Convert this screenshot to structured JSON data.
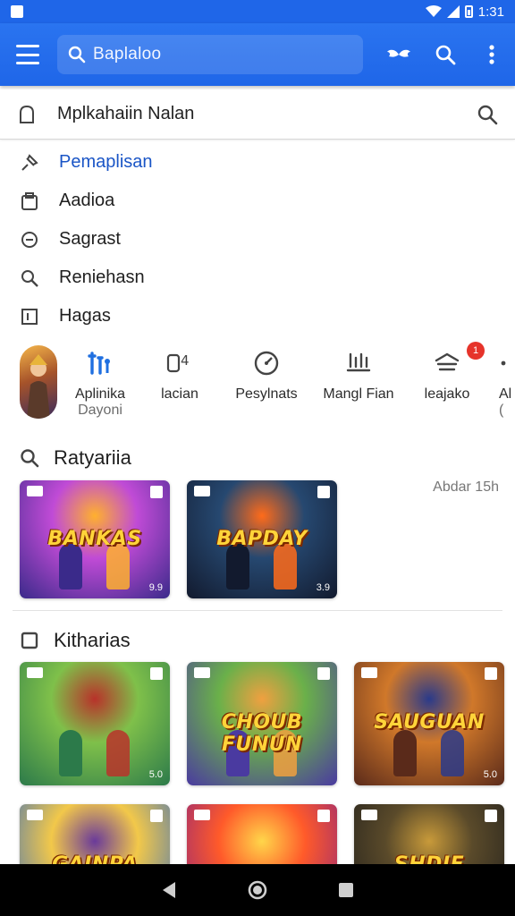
{
  "status_bar": {
    "time": "1:31"
  },
  "app_bar": {
    "search_text": "Baplaloo",
    "icons": [
      "menu-icon",
      "search-icon",
      "more-icon",
      "wings-icon"
    ]
  },
  "search_field": {
    "text": "Mplkahaiin Nalan"
  },
  "menu": {
    "items": [
      {
        "label": "Pemaplisan",
        "icon": "pin-icon",
        "active": true
      },
      {
        "label": "Aadioa",
        "icon": "folder-icon",
        "active": false
      },
      {
        "label": "Sagrast",
        "icon": "circle-icon",
        "active": false
      },
      {
        "label": "Reniehasn",
        "icon": "magnify-icon",
        "active": false
      },
      {
        "label": "Hagas",
        "icon": "square-icon",
        "active": false
      }
    ]
  },
  "categories": [
    {
      "label": "Aplinika",
      "sublabel": "Dayoni",
      "icon": "tools-icon"
    },
    {
      "label": "lacian",
      "sublabel": "",
      "icon": "device-icon"
    },
    {
      "label": "Pesylnats",
      "sublabel": "",
      "icon": "gauge-icon"
    },
    {
      "label": "Mangl Fian",
      "sublabel": "",
      "icon": "antenna-icon"
    },
    {
      "label": "leajako",
      "sublabel": "",
      "icon": "layers-icon",
      "badge": "1"
    },
    {
      "label": "Al",
      "sublabel": "(",
      "icon": "more-icon"
    }
  ],
  "sections": {
    "top": {
      "title": "Ratyariia",
      "meta": "Abdar 15h"
    },
    "second": {
      "title": "Kitharias"
    }
  },
  "top_cards": [
    {
      "title": "BANKAS",
      "num": "9.9",
      "colors": [
        "#3a2a8a",
        "#c04bd6",
        "#ffb02e"
      ]
    },
    {
      "title": "BAPDAY",
      "num": "3.9",
      "colors": [
        "#121a2e",
        "#264870",
        "#ff6b1a"
      ]
    }
  ],
  "grid_cards": [
    {
      "title": "",
      "num": "5.0",
      "colors": [
        "#2c7a4a",
        "#7fc04a",
        "#b8322a"
      ]
    },
    {
      "title": "CHOUB FUNUN",
      "num": "",
      "colors": [
        "#4a3aa0",
        "#6ab04a",
        "#f0a040"
      ]
    },
    {
      "title": "SAUGUAN",
      "num": "5.0",
      "colors": [
        "#5a2a1a",
        "#d0782a",
        "#2a3a8a"
      ]
    },
    {
      "title": "GAINPA",
      "num": "",
      "colors": [
        "#2a66c8",
        "#f2c84a",
        "#6a3a9a"
      ]
    },
    {
      "title": "",
      "num": "",
      "colors": [
        "#7a1a8a",
        "#ff5a2a",
        "#ffd64a"
      ]
    },
    {
      "title": "SHDIE BEAREU",
      "num": "",
      "colors": [
        "#1a1a1a",
        "#5a4a2a",
        "#c89a3a"
      ]
    }
  ]
}
